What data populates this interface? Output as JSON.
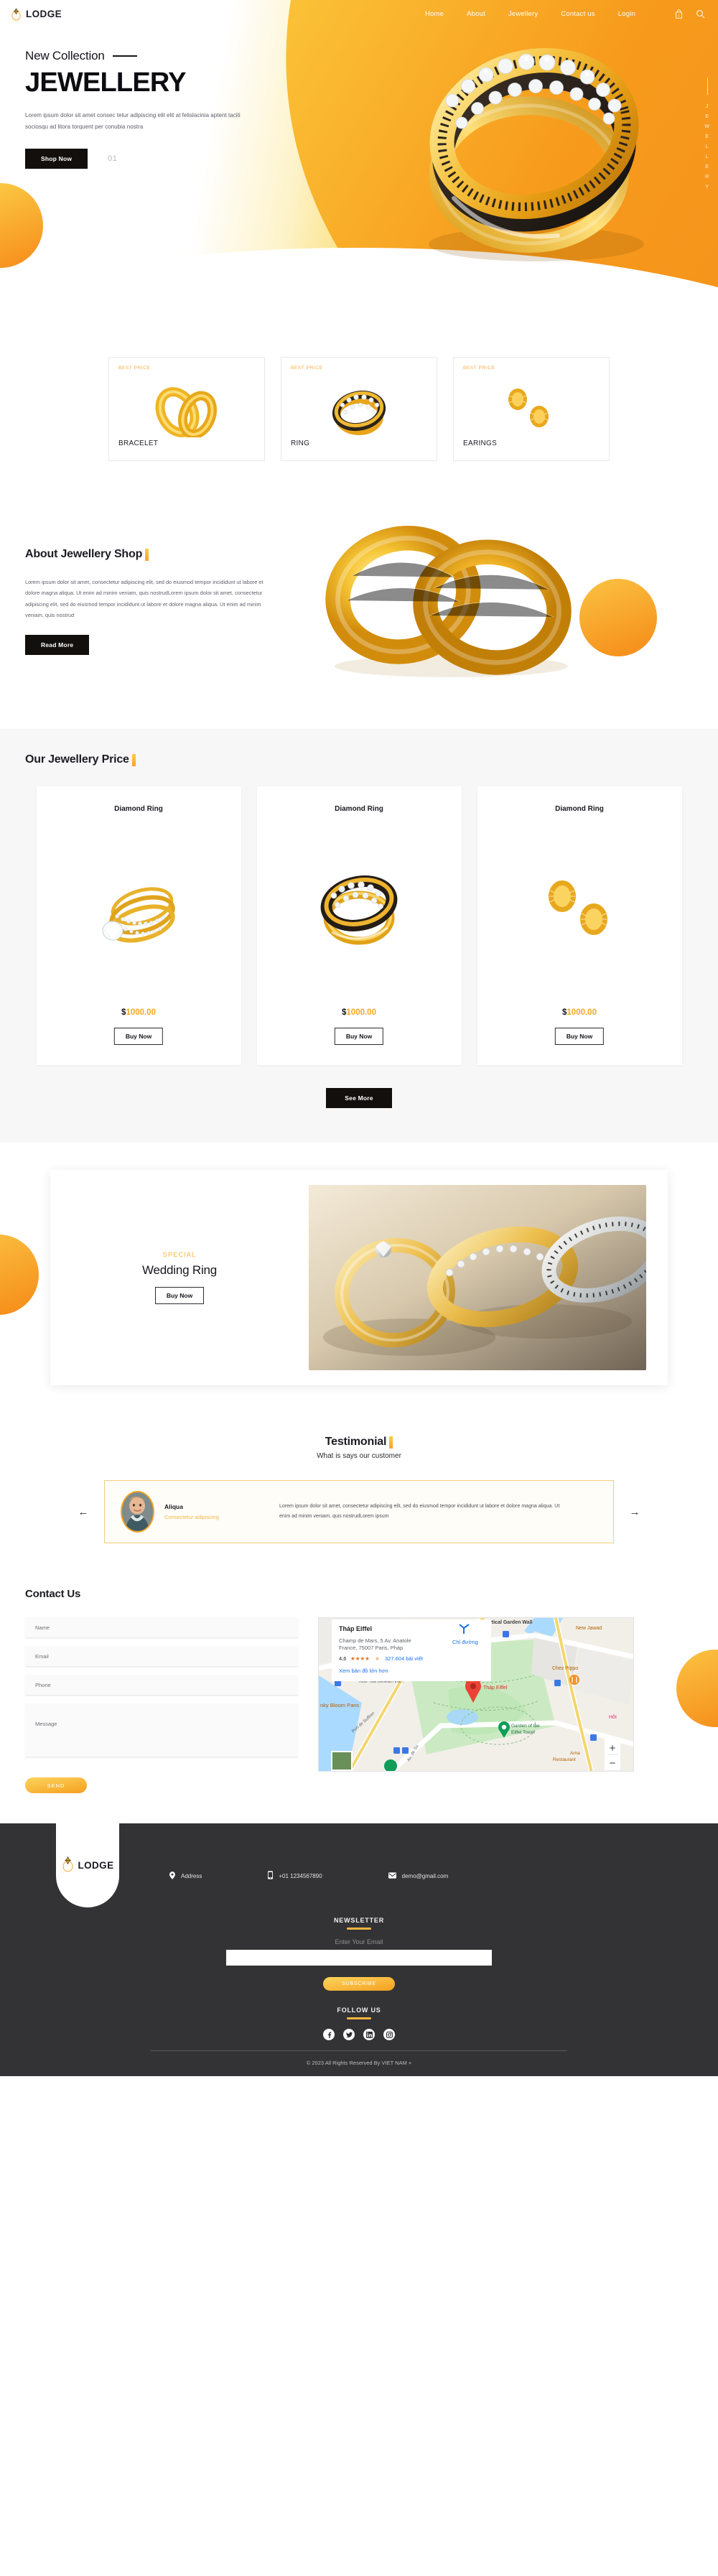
{
  "brand": {
    "name": "LODGE",
    "logo_icon": "ring-logo-icon"
  },
  "nav": {
    "items": [
      {
        "label": "Home"
      },
      {
        "label": "About"
      },
      {
        "label": "Jewellery"
      },
      {
        "label": "Contact us"
      },
      {
        "label": "Login"
      }
    ],
    "cart_icon": "shopping-bag-icon",
    "cart_count": "0",
    "search_icon": "search-icon"
  },
  "hero": {
    "eyebrow": "New Collection",
    "title": "JEWELLERY",
    "text": "Lorem ipsum dolor sit amet consec tetur adipiscing elit elit at felislacinia aptent taciti sociosqu ad litora torquent per conubia nostra",
    "cta": "Shop Now",
    "slide_number": "01",
    "vertical_label": "JEWELLERY"
  },
  "categories": [
    {
      "badge": "BEST PRICE",
      "name": "BRACELET",
      "image_icon": "gold-bracelets-image"
    },
    {
      "badge": "BEST PRICE",
      "name": "RING",
      "image_icon": "diamond-ring-image"
    },
    {
      "badge": "BEST PRICE",
      "name": "EARINGS",
      "image_icon": "gold-earrings-image"
    }
  ],
  "about": {
    "heading": "About Jewellery Shop",
    "text": "Lorem ipsum dolor sit amet, consectetur adipiscing elit, sed do eiusmod tempor incididunt ut labore et dolore magna aliqua. Ut enim ad minim veniam, quis nostrudLorem ipsum dolor sit amet, consectetur adipiscing elit, sed do eiusmod tempor incididunt ut labore et dolore magna aliqua. Ut enim ad minim veniam, quis nostrud",
    "cta": "Read More",
    "image_icon": "gold-bangles-image"
  },
  "price": {
    "heading": "Our Jewellery Price",
    "see_more": "See More",
    "products": [
      {
        "title": "Diamond Ring",
        "currency": "$",
        "amount": "1000.00",
        "cta": "Buy Now",
        "image_icon": "solitaire-ring-image"
      },
      {
        "title": "Diamond Ring",
        "currency": "$",
        "amount": "1000.00",
        "cta": "Buy Now",
        "image_icon": "gold-diamond-ring-image"
      },
      {
        "title": "Diamond Ring",
        "currency": "$",
        "amount": "1000.00",
        "cta": "Buy Now",
        "image_icon": "gold-earrings-image"
      }
    ]
  },
  "wedding": {
    "kicker": "SPECIAL",
    "title": "Wedding Ring",
    "cta": "Buy Now",
    "image_icon": "wedding-rings-photo"
  },
  "testimonial": {
    "heading": "Testimonial",
    "subheading": "What is says our customer",
    "prev_icon": "arrow-left-icon",
    "next_icon": "arrow-right-icon",
    "name": "Aliqua",
    "role": "Consectetur adipiscing",
    "quote": "Lorem ipsum dolor sit amet, consectetur adipiscing elit, sed do eiusmod tempor incididunt ut labore et dolore magna aliqua. Ut enim ad minim veniam, quis nostrudLorem ipsum",
    "avatar_icon": "customer-avatar"
  },
  "contact": {
    "heading": "Contact Us",
    "fields": {
      "name": "Name",
      "email": "Email",
      "phone": "Phone",
      "message": "Message"
    },
    "submit": "SEND",
    "map": {
      "title": "Tháp Eiffel",
      "address_line1": "Champ de Mars, 5 Av. Anatole",
      "address_line2": "France, 75007 Paris, Pháp",
      "rating": "4,6",
      "stars": "★★★★",
      "reviews": "327.604 bài viết",
      "larger_map": "Xem bản đồ lớn hơn",
      "directions": "Chỉ đường",
      "marker_label": "Tháp Eiffel",
      "poi_garden": "Garden of the Eiffel Tower",
      "poi_wall": "Vertical Garden Wall",
      "poi_jawad": "New Jawad",
      "poi_pippo": "Chez Pippo",
      "poi_bloom": "nky Bloom Paris",
      "poi_suffren": "Port de Suffren",
      "poi_av": "Av. de Su",
      "zoom_in": "+",
      "zoom_out": "−"
    }
  },
  "footer": {
    "brand": "LODGE",
    "contacts": [
      {
        "icon": "location-pin-icon",
        "label": "Address"
      },
      {
        "icon": "phone-icon",
        "label": "+01 1234567890"
      },
      {
        "icon": "envelope-icon",
        "label": "demo@gmail.com"
      }
    ],
    "newsletter": {
      "heading": "NEWSLETTER",
      "label": "Enter Your Email",
      "value": "",
      "placeholder": "",
      "button": "SUBSCRIBE"
    },
    "follow": {
      "heading": "FOLLOW US",
      "socials": [
        {
          "icon": "facebook-icon"
        },
        {
          "icon": "twitter-icon"
        },
        {
          "icon": "linkedin-icon"
        },
        {
          "icon": "instagram-icon"
        }
      ]
    },
    "copyright": "© 2023 All Rights Reserved By VIET NAM +"
  },
  "colors": {
    "accent": "#f5a623",
    "accent_light": "#fbd75a",
    "dark": "#120f0d",
    "footer_bg": "#333335"
  }
}
